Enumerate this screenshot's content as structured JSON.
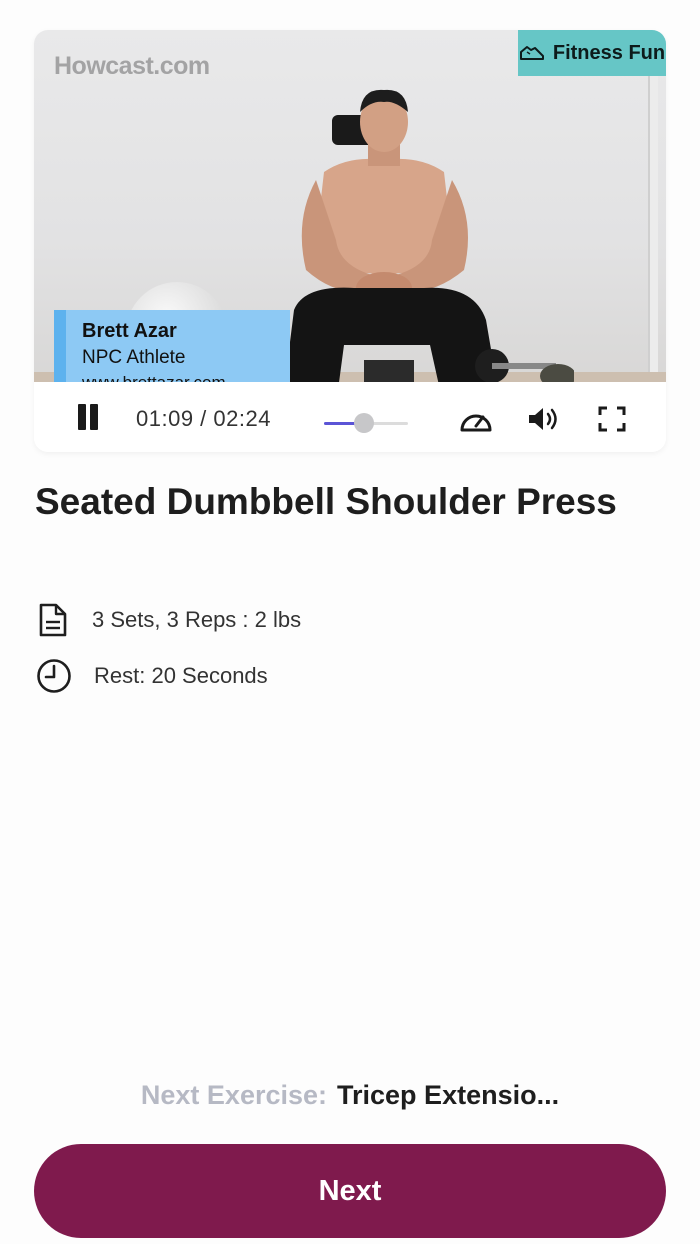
{
  "video": {
    "watermark": "Howcast.com",
    "channel_badge": "Fitness Fun",
    "lower_third": {
      "name": "Brett Azar",
      "role": "NPC Athlete",
      "url": "www.brettazar.com"
    },
    "controls": {
      "time": "01:09 / 02:24",
      "progress_fraction": 0.48,
      "icons": [
        "pause-icon",
        "speed-icon",
        "volume-icon",
        "fullscreen-icon"
      ]
    }
  },
  "exercise": {
    "title": "Seated Dumbbell Shoulder Press",
    "sets_reps": "3 Sets, 3 Reps : 2 lbs",
    "rest": "Rest: 20 Seconds"
  },
  "footer": {
    "next_label": "Next Exercise:",
    "next_value": "Tricep Extensio...",
    "next_button": "Next"
  },
  "colors": {
    "accent": "#7f1a4d",
    "badge": "#66c6c6",
    "seek": "#5b54d6",
    "lower_third": "#8dc9f4"
  }
}
